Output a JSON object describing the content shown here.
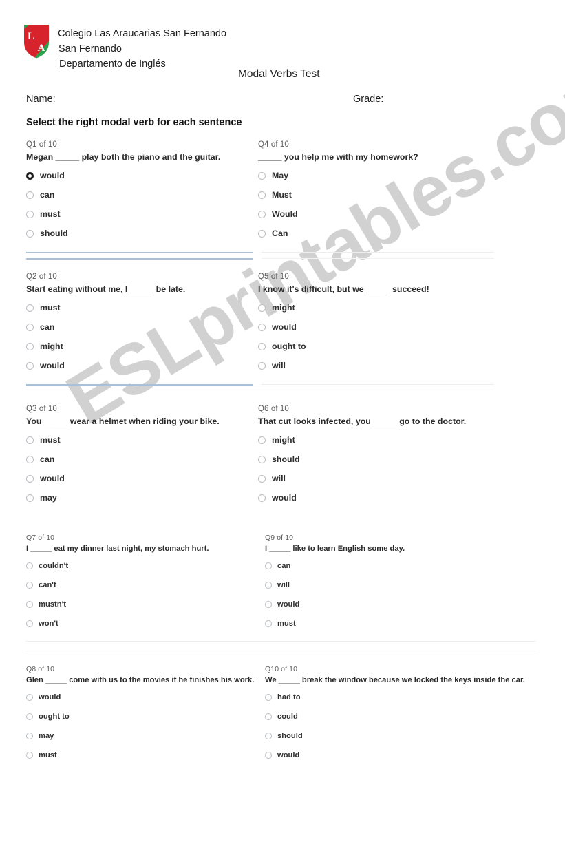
{
  "header": {
    "school_name": "Colegio Las Araucarias San Fernando",
    "school_city": "San Fernando",
    "department": "Departamento de Inglés",
    "doc_title": "Modal Verbs Test",
    "name_label": "Name:",
    "grade_label": "Grade:",
    "logo_letters": [
      "L",
      "A"
    ],
    "logo_colors": {
      "shield_green": "#2aa14b",
      "shield_red": "#d7242c",
      "outline": "#ffffff"
    }
  },
  "instruction": "Select the right modal verb for each sentence",
  "watermark": "ESLprintables.com",
  "questions": [
    {
      "number": "Q1 of 10",
      "text": "Megan _____ play both the piano and the guitar.",
      "options": [
        "would",
        "can",
        "must",
        "should"
      ],
      "selected": 0
    },
    {
      "number": "Q2 of 10",
      "text": "Start eating without me, I _____ be late.",
      "options": [
        "must",
        "can",
        "might",
        "would"
      ],
      "selected": -1
    },
    {
      "number": "Q3 of 10",
      "text": "You _____ wear a helmet when riding your bike.",
      "options": [
        "must",
        "can",
        "would",
        "may"
      ],
      "selected": -1
    },
    {
      "number": "Q4 of 10",
      "text": "_____ you help me with my homework?",
      "options": [
        "May",
        "Must",
        "Would",
        "Can"
      ],
      "selected": -1
    },
    {
      "number": "Q5 of 10",
      "text": "I know it's difficult, but we _____ succeed!",
      "options": [
        "might",
        "would",
        "ought to",
        "will"
      ],
      "selected": -1
    },
    {
      "number": "Q6 of 10",
      "text": "That cut looks infected, you _____ go to the doctor.",
      "options": [
        "might",
        "should",
        "will",
        "would"
      ],
      "selected": -1
    },
    {
      "number": "Q7 of 10",
      "text": "I _____ eat my dinner last night, my stomach hurt.",
      "options": [
        "couldn't",
        "can't",
        "mustn't",
        "won't"
      ],
      "selected": -1
    },
    {
      "number": "Q8 of 10",
      "text": "Glen _____ come with us to the movies if he finishes his work.",
      "options": [
        "would",
        "ought to",
        "may",
        "must"
      ],
      "selected": -1
    },
    {
      "number": "Q9 of 10",
      "text": "I _____ like to learn English some day.",
      "options": [
        "can",
        "will",
        "would",
        "must"
      ],
      "selected": -1
    },
    {
      "number": "Q10 of 10",
      "text": "We _____ break the window because we locked the keys inside the car.",
      "options": [
        "had to",
        "could",
        "should",
        "would"
      ],
      "selected": -1
    }
  ]
}
